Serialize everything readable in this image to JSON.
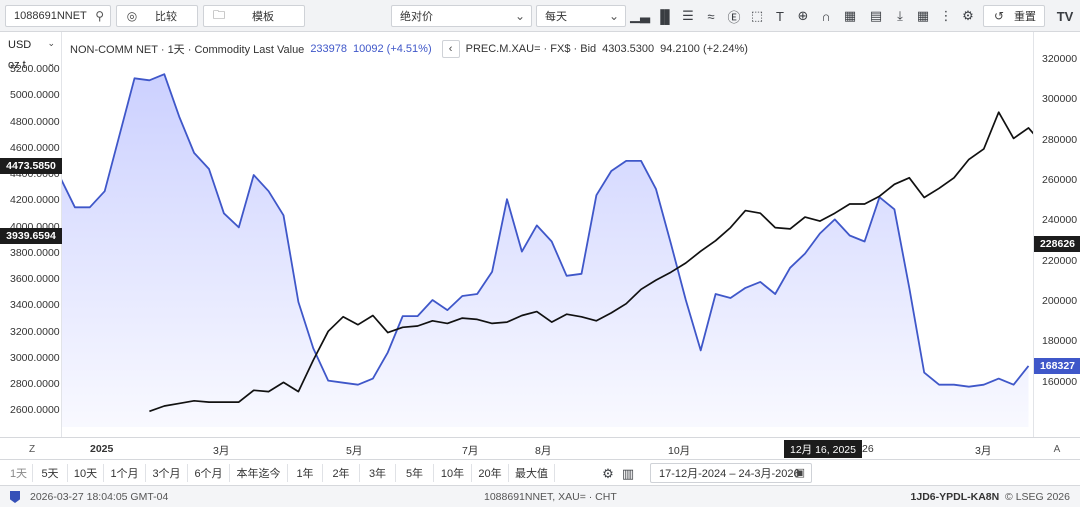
{
  "toolbar": {
    "symbol": "1088691NNET",
    "compare_label": "比较",
    "template_label": "模板",
    "scale_mode": "绝对价",
    "interval": "每天",
    "reset_label": "重置",
    "logo": "TV"
  },
  "left_panel": {
    "currency": "USD",
    "unit": "oz t"
  },
  "legend": {
    "series1_name": "NON-COMM NET · 1天 · Commodity Last Value",
    "series1_value": "233978",
    "series1_change": "10092 (+4.51%)",
    "series2_name": "PREC.M.XAU= · FX$ · Bid",
    "series2_value": "4303.5300",
    "series2_change": "94.2100 (+2.24%)"
  },
  "left_badges": {
    "gold_last": "4473.5850",
    "crosshair": "3939.6594"
  },
  "right_badges": {
    "crosshair": "228626",
    "cot_last": "168327"
  },
  "xaxis": {
    "labels": [
      "2025",
      "3月",
      "5月",
      "7月",
      "8月",
      "10月",
      "3月"
    ],
    "hover_date": "12月 16, 2025",
    "hover_tail": "26",
    "left_corner": "Z",
    "right_corner": "A"
  },
  "range_buttons": [
    "1天",
    "5天",
    "10天",
    "1个月",
    "3个月",
    "6个月",
    "本年迄今",
    "1年",
    "2年",
    "3年",
    "5年",
    "10年",
    "20年",
    "最大值"
  ],
  "date_range": "17-12月-2024 ‒ 24-3月-2026",
  "status": {
    "timestamp": "2026-03-27 18:04:05 GMT-04",
    "ric": "1088691NNET, XAU= · CHT",
    "code": "1JD6-YPDL-KA8N",
    "copyright": "© LSEG 2026"
  },
  "colors": {
    "cot_line": "#3f57c9",
    "cot_fill": "#c9ceff",
    "gold_line": "#111111",
    "badge_dark": "#1c1c1c",
    "badge_blue": "#3f57c9"
  },
  "chart_data": {
    "type": "line",
    "title": "",
    "x_type": "weeks",
    "left_axis": {
      "label": "USD oz t",
      "range": [
        2480,
        5400
      ],
      "ticks": [
        "2600.0000",
        "2800.0000",
        "3000.0000",
        "3200.0000",
        "3400.0000",
        "3600.0000",
        "3800.0000",
        "3900.0000",
        "4000.0000",
        "4200.0000",
        "4400.0000",
        "4600.0000",
        "4800.0000",
        "5000.0000",
        "5200.0000"
      ]
    },
    "right_axis": {
      "range": [
        138000,
        328000
      ],
      "ticks": [
        "160000",
        "180000",
        "200000",
        "220000",
        "240000",
        "260000",
        "280000",
        "300000",
        "320000"
      ]
    },
    "series": [
      {
        "name": "NON-COMM NET",
        "axis": "right",
        "style": "area",
        "start_date": "2024-12-17",
        "values": [
          262000,
          247000,
          247000,
          255000,
          283000,
          311000,
          310000,
          313000,
          292000,
          274000,
          266000,
          244000,
          237000,
          263000,
          255000,
          243000,
          200000,
          177000,
          161000,
          160000,
          159000,
          162000,
          175000,
          193000,
          193000,
          201000,
          196000,
          203000,
          204000,
          215000,
          251000,
          225000,
          238000,
          230000,
          213000,
          214000,
          253000,
          265000,
          270000,
          270000,
          256000,
          229000,
          201000,
          176000,
          204000,
          202000,
          207000,
          210000,
          204000,
          217000,
          224000,
          234000,
          241000,
          233000,
          230000,
          252000,
          246000,
          207000,
          165000,
          159000,
          159000,
          158000,
          159000,
          162000,
          159000,
          168327
        ]
      },
      {
        "name": "PREC.M.XAU=",
        "axis": "left",
        "style": "line",
        "start_offset": 6,
        "values": [
          2600,
          2640,
          2660,
          2680,
          2670,
          2670,
          2670,
          2760,
          2750,
          2820,
          2750,
          2990,
          3210,
          3320,
          3260,
          3330,
          3200,
          3240,
          3250,
          3290,
          3270,
          3310,
          3300,
          3270,
          3280,
          3330,
          3360,
          3280,
          3340,
          3320,
          3290,
          3350,
          3420,
          3530,
          3600,
          3660,
          3730,
          3820,
          3900,
          4000,
          4130,
          4110,
          4000,
          3990,
          4080,
          4050,
          4110,
          4180,
          4180,
          4240,
          4330,
          4380,
          4230,
          4300,
          4380,
          4520,
          4600,
          4880,
          4680,
          4760,
          4630,
          4890,
          4850,
          4960,
          4810,
          4473.585
        ]
      }
    ]
  }
}
